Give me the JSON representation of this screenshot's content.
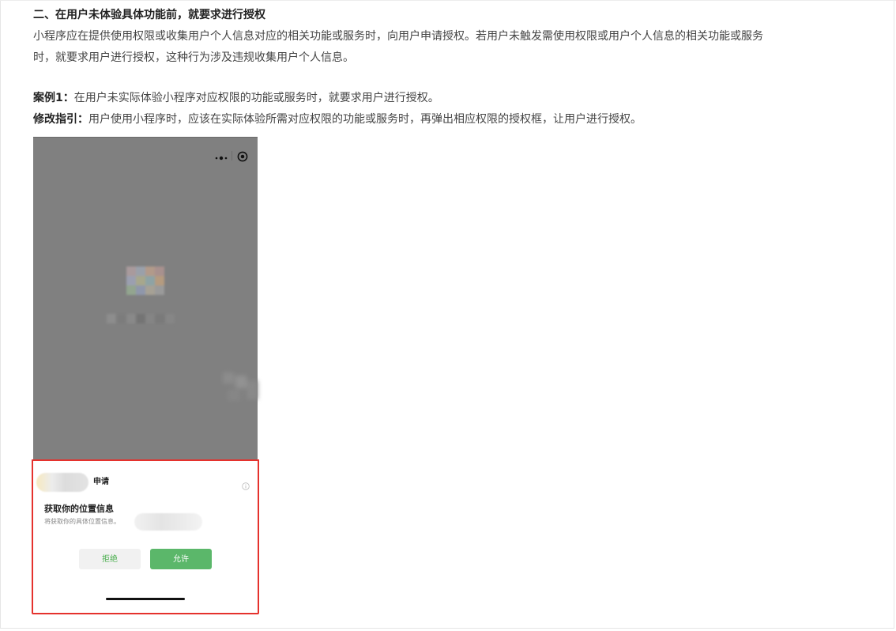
{
  "article": {
    "heading": "二、在用户未体验具体功能前，就要求进行授权",
    "paragraph_line1": "小程序应在提供使用权限或收集用户个人信息对应的相关功能或服务时，向用户申请授权。若用户未触发需使用权限或用户个人信息的相关功能或服务",
    "paragraph_line2": "时，就要求用户进行授权，这种行为涉及违规收集用户个人信息。",
    "case_label": "案例1：",
    "case_text": "在用户未实际体验小程序对应权限的功能或服务时，就要求用户进行授权。",
    "guide_label": "修改指引：",
    "guide_text": "用户使用小程序时，应该在实际体验所需对应权限的功能或服务时，再弹出相应权限的授权框，让用户进行授权。"
  },
  "phone_screenshot": {
    "capsule_icons": [
      "more-icon",
      "target-icon"
    ],
    "auth_sheet": {
      "apply_text": "申请",
      "title": "获取你的位置信息",
      "description": "将获取你的具体位置信息。",
      "reject_label": "拒绝",
      "allow_label": "允许",
      "info_icon": "info-icon"
    }
  },
  "colors": {
    "overlay_gray": "#808080",
    "highlight_border": "#e5322d",
    "allow_green": "#5bb76a",
    "reject_text_green": "#4caf50"
  }
}
